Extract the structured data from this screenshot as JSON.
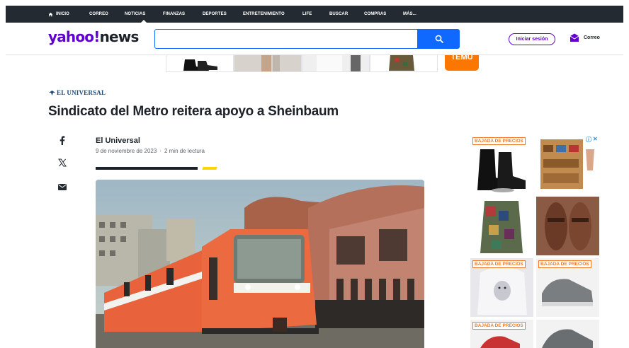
{
  "nav": {
    "items": [
      "INICIO",
      "CORREO",
      "NOTICIAS",
      "FINANZAS",
      "DEPORTES",
      "ENTRETENIMIENTO",
      "LIFE",
      "BUSCAR",
      "COMPRAS",
      "MÁS..."
    ],
    "active": "NOTICIAS"
  },
  "header": {
    "logo_yahoo": "yahoo!",
    "logo_news": "news",
    "search_value": "",
    "signin_label": "Iniciar sesión",
    "mail_label": "Correo"
  },
  "ads": {
    "temu_label": "TEMU",
    "side_tags": [
      "BAJADA DE PRECIOS",
      "BAJADA DE PRECIOS",
      "BAJADA DE PRECIOS",
      "BAJADA DE PRECIOS"
    ]
  },
  "article": {
    "source": "EL UNIVERSAL",
    "headline": "Sindicato del Metro reitera apoyo a Sheinbaum",
    "author": "El Universal",
    "date": "9 de noviembre de 2023",
    "separator": "·",
    "read_time": "2 min de lectura"
  },
  "colors": {
    "nav_bg": "#232a31",
    "brand_purple": "#6001d2",
    "search_blue": "#0f69ff",
    "temu_orange": "#fb7701",
    "accent_yellow": "#ffd600"
  }
}
